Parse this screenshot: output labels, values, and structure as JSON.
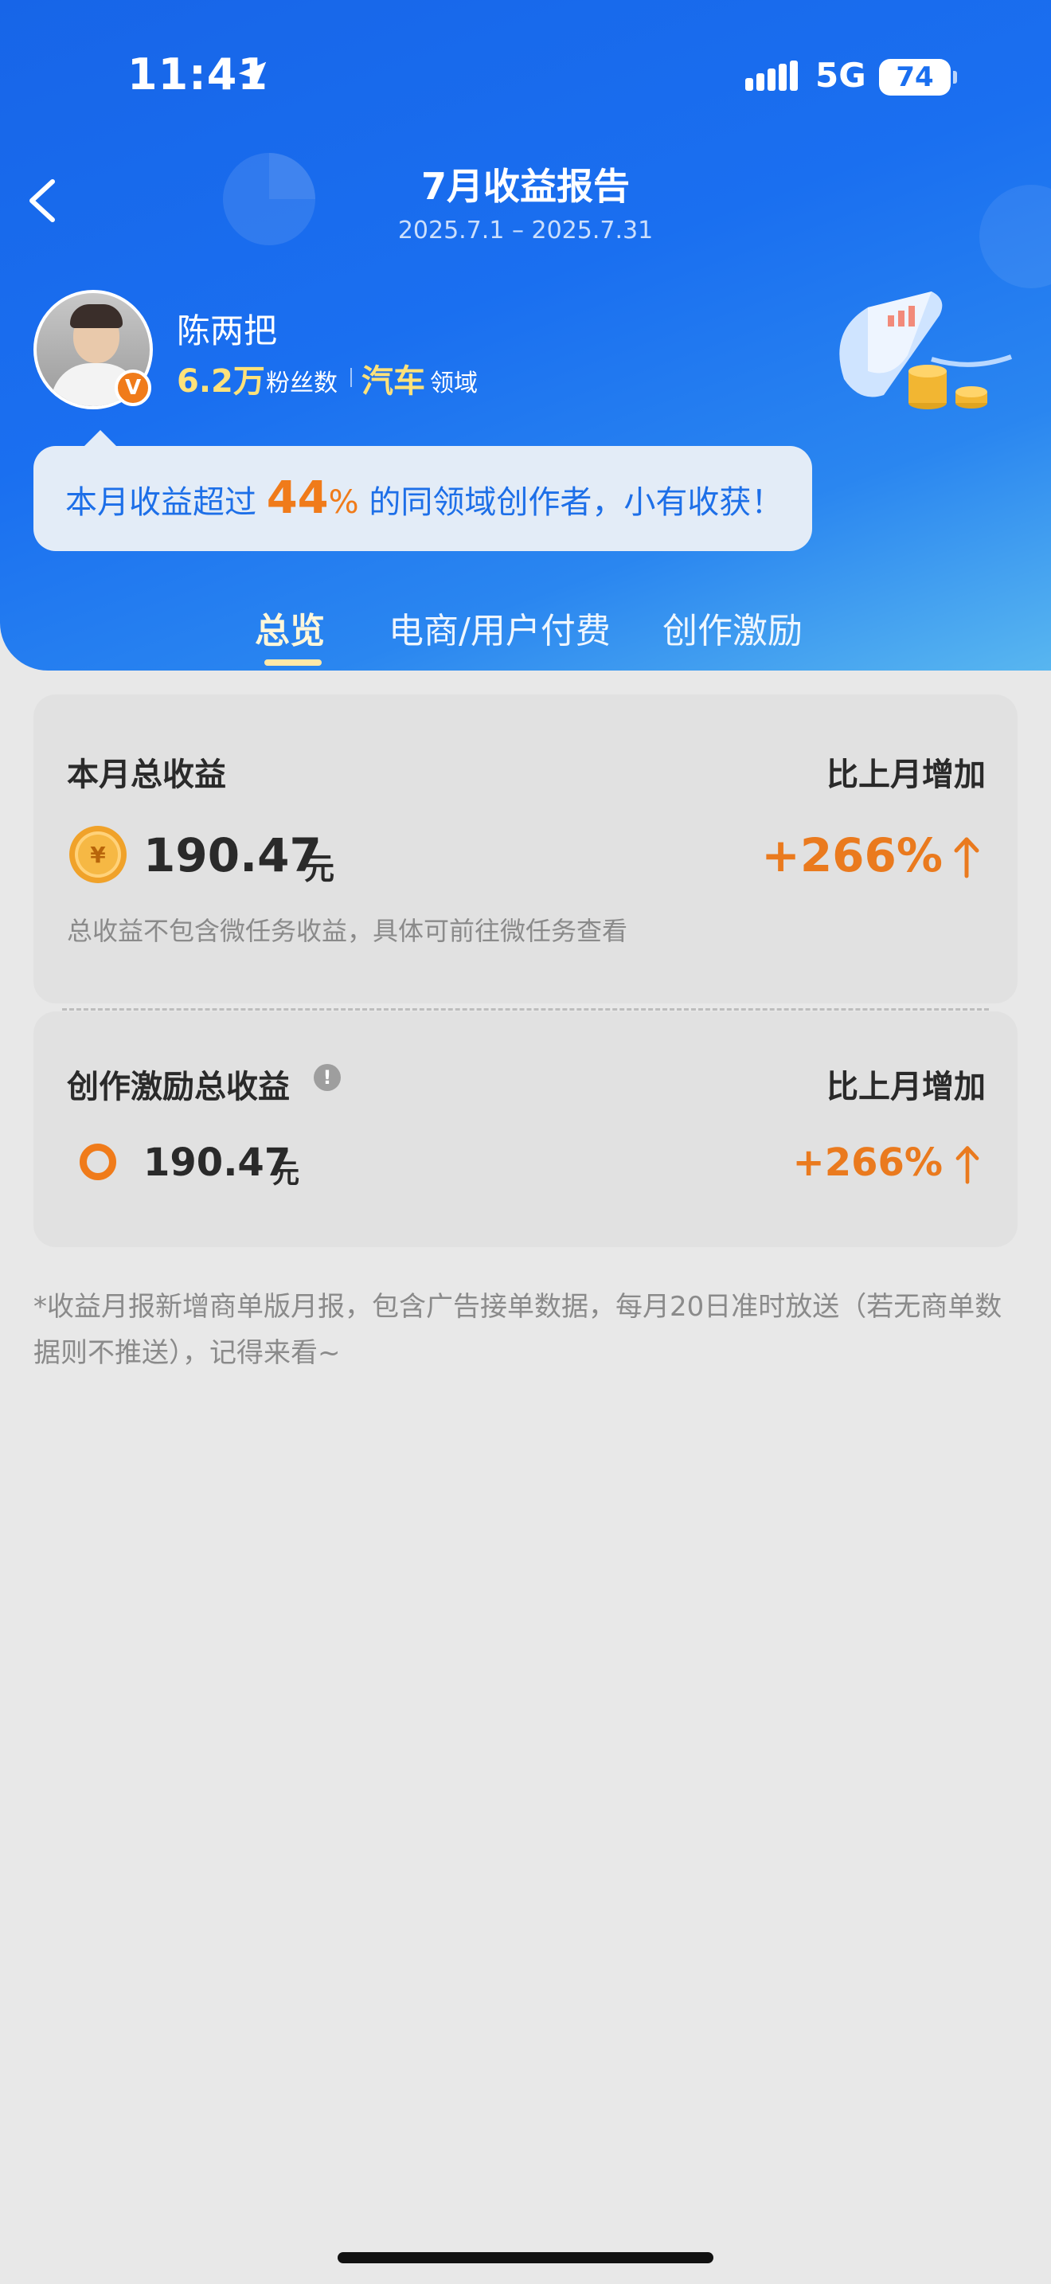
{
  "status_bar": {
    "time": "11:41",
    "network": "5G",
    "battery": "74"
  },
  "nav": {
    "title": "7月收益报告",
    "date_range": "2025.7.1 – 2025.7.31"
  },
  "profile": {
    "name": "陈两把",
    "fans_count": "6.2万",
    "fans_label": "粉丝数",
    "field": "汽车",
    "field_label": "领域",
    "badge": "V"
  },
  "bubble": {
    "prefix": "本月收益超过 ",
    "percent": "44",
    "percent_sign": "%",
    "suffix": " 的同领域创作者，小有收获！"
  },
  "tabs": [
    {
      "label": "总览",
      "active": true
    },
    {
      "label": "电商/用户付费",
      "active": false
    },
    {
      "label": "创作激励",
      "active": false
    }
  ],
  "total_card": {
    "title": "本月总收益",
    "compare_label": "比上月增加",
    "amount": "190.47",
    "unit": "元",
    "growth": "+266%",
    "note": "总收益不包含微任务收益，具体可前往微任务查看",
    "coin_symbol": "¥"
  },
  "incentive_card": {
    "title": "创作激励总收益",
    "compare_label": "比上月增加",
    "amount": "190.47",
    "unit": "元",
    "growth": "+266%",
    "info_symbol": "!"
  },
  "footnote": "*收益月报新增商单版月报，包含广告接单数据，每月20日准时放送（若无商单数据则不推送），记得来看~",
  "colors": {
    "brand_blue": "#1a6ff0",
    "accent_orange": "#ea7a1e",
    "highlight_yellow": "#ffe27a"
  }
}
